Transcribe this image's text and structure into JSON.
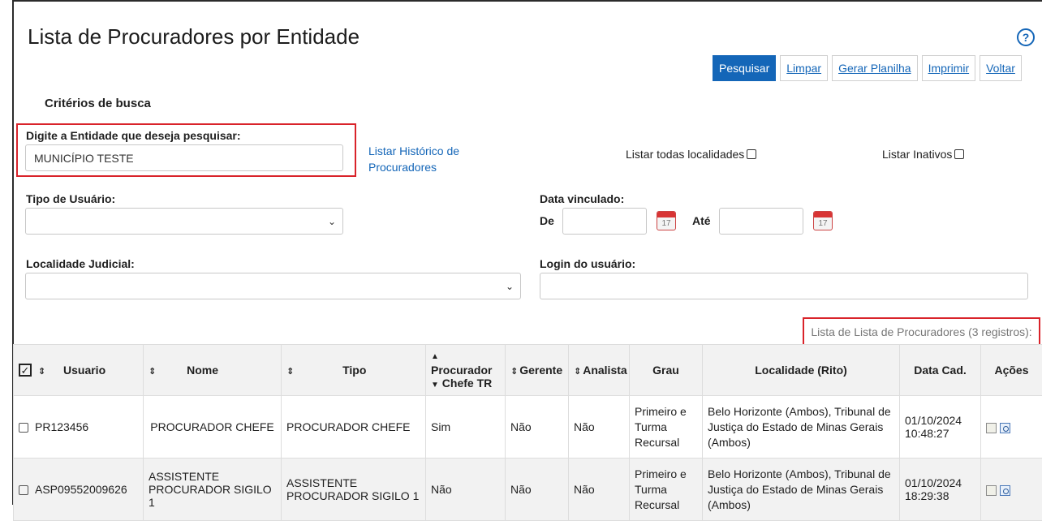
{
  "page": {
    "title": "Lista de Procuradores por Entidade",
    "help_icon": "help-circle-icon"
  },
  "toolbar": {
    "pesquisar": "Pesquisar",
    "limpar": "Limpar",
    "gerar_planilha": "Gerar Planilha",
    "imprimir": "Imprimir",
    "voltar": "Voltar"
  },
  "criteria": {
    "title": "Critérios de busca",
    "entidade_label": "Digite a Entidade que deseja pesquisar:",
    "entidade_value": "MUNICÍPIO TESTE",
    "historico_link_line1": "Listar Histórico de",
    "historico_link_line2": "Procuradores",
    "listar_localidades": "Listar todas localidades",
    "listar_inativos": "Listar Inativos",
    "tipo_usuario_label": "Tipo de Usuário:",
    "tipo_usuario_value": "",
    "data_vinculado_label": "Data vinculado:",
    "de_label": "De",
    "ate_label": "Até",
    "calendar_num": "17",
    "localidade_label": "Localidade Judicial:",
    "localidade_value": "",
    "login_label": "Login do usuário:",
    "login_value": ""
  },
  "results": {
    "count_label": "Lista de Lista de Procuradores (3 registros):",
    "columns": {
      "usuario": "Usuario",
      "nome": "Nome",
      "tipo": "Tipo",
      "procurador_1": "Procurador",
      "procurador_2": "Chefe TR",
      "gerente": "Gerente",
      "analista": "Analista",
      "grau": "Grau",
      "localidade": "Localidade (Rito)",
      "data_cad": "Data Cad.",
      "acoes": "Ações"
    },
    "rows": [
      {
        "usuario": "PR123456",
        "nome": "PROCURADOR CHEFE",
        "tipo": "PROCURADOR CHEFE",
        "procurador": "Sim",
        "gerente": "Não",
        "analista": "Não",
        "grau": "Primeiro e Turma Recursal",
        "localidade": "Belo Horizonte (Ambos), Tribunal de Justiça do Estado de Minas Gerais (Ambos)",
        "data_cad_1": "01/10/2024",
        "data_cad_2": "10:48:27"
      },
      {
        "usuario": "ASP09552009626",
        "nome": "ASSISTENTE PROCURADOR SIGILO 1",
        "tipo": "ASSISTENTE PROCURADOR SIGILO 1",
        "procurador": "Não",
        "gerente": "Não",
        "analista": "Não",
        "grau": "Primeiro e Turma Recursal",
        "localidade": "Belo Horizonte (Ambos), Tribunal de Justiça do Estado de Minas Gerais (Ambos)",
        "data_cad_1": "01/10/2024",
        "data_cad_2": "18:29:38"
      }
    ]
  },
  "colors": {
    "accent": "#1466b8",
    "highlight": "#d9232a"
  }
}
